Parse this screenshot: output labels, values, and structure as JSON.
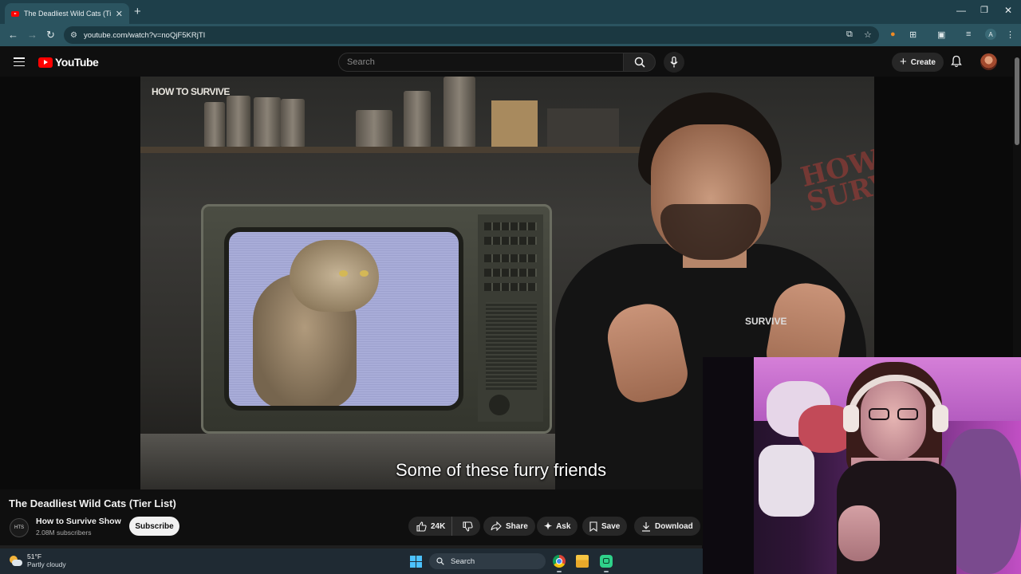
{
  "browser": {
    "tab_title": "The Deadliest Wild Cats (Tier Li",
    "url": "youtube.com/watch?v=noQjF5KRjTI",
    "profile_initial": "A"
  },
  "youtube": {
    "logo_text": "YouTube",
    "search_placeholder": "Search",
    "create_label": "Create"
  },
  "video": {
    "caption": "Some of these furry friends",
    "overlay_logo": "HOW TO SURVIVE",
    "title": "The Deadliest Wild Cats (Tier List)",
    "channel_name": "How to Survive Show",
    "subscribers": "2.08M subscribers",
    "subscribe_label": "Subscribe",
    "likes": "24K",
    "share_label": "Share",
    "ask_label": "Ask",
    "save_label": "Save",
    "download_label": "Download"
  },
  "taskbar": {
    "temperature": "51°F",
    "weather": "Partly cloudy",
    "search_label": "Search"
  },
  "colors": {
    "youtube_red": "#ff0000",
    "browser_frame": "#2b5460",
    "page_bg": "#0f0f0f",
    "webcam_glow": "#c14fc4"
  }
}
